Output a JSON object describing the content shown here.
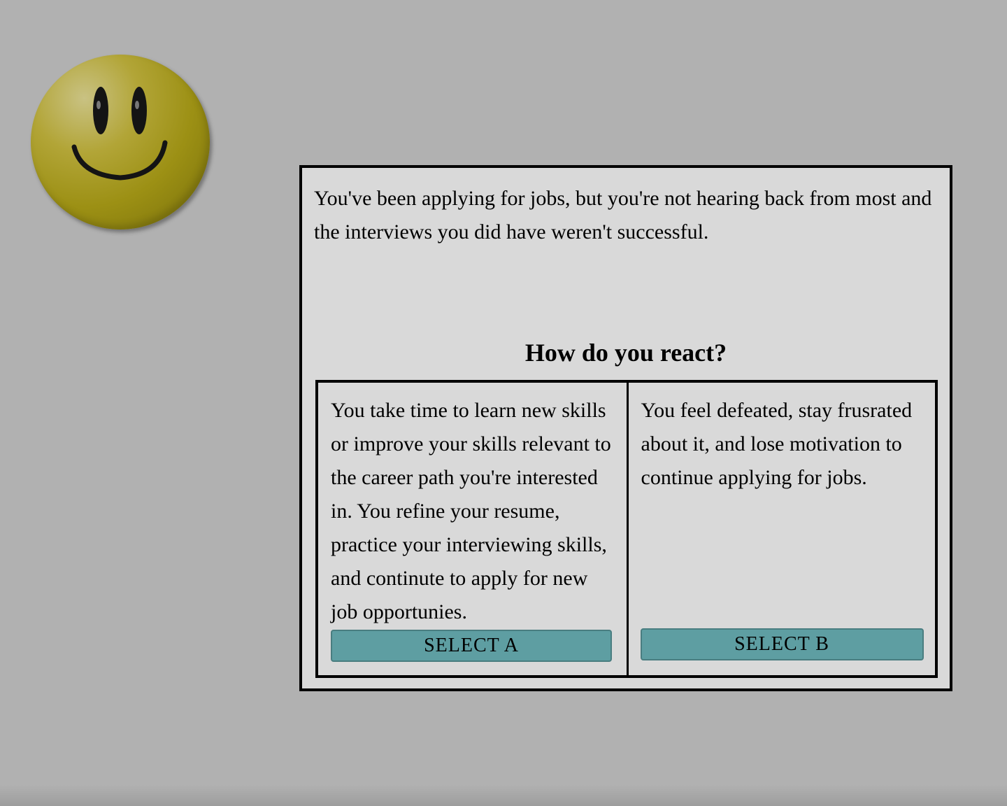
{
  "avatar": {
    "icon": "smiley-face-icon",
    "color": "#9c9014"
  },
  "scenario": {
    "text": "You've been applying for jobs, but you're not hearing back from most and the interviews you did have weren't successful."
  },
  "question": {
    "text": "How do you react?"
  },
  "options": [
    {
      "text": "You take time to learn new skills or improve your skills relevant to the career path you're interested in. You refine your resume, practice your interviewing skills, and continute to apply for new job opportunies.",
      "button_label": "SELECT A"
    },
    {
      "text": "You feel defeated, stay frusrated about it, and lose motivation to continue applying for jobs.",
      "button_label": "SELECT B"
    }
  ],
  "colors": {
    "background": "#b1b1b1",
    "panel": "#d9d9d9",
    "button": "#5e9ea2"
  }
}
